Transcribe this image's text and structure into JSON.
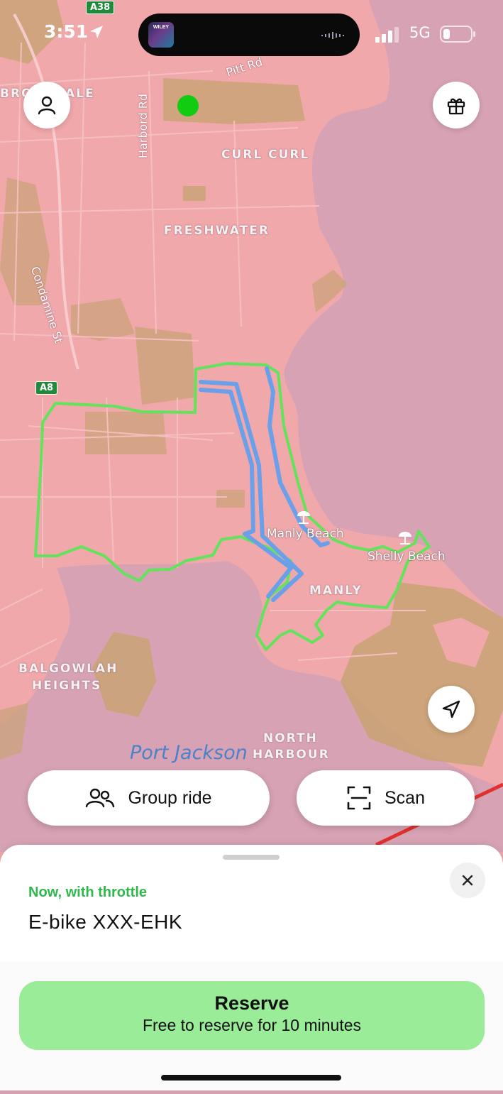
{
  "status_bar": {
    "time": "3:51",
    "network": "5G",
    "now_playing_art": "WILEY"
  },
  "map": {
    "place_labels": [
      "CURL CURL",
      "FRESHWATER",
      "MANLY",
      "BALGOWLAH",
      "HEIGHTS",
      "NORTH",
      "HARBOUR",
      "BROOKVALE"
    ],
    "road_labels": [
      "Pitt Rd",
      "Harbord Rd",
      "Condamine St"
    ],
    "shields": [
      "A38",
      "A8"
    ],
    "pois": [
      "Manly Beach",
      "Shelly Beach"
    ],
    "water_label": "Port Jackson",
    "colors": {
      "land": "#f0a8ab",
      "water": "#d7a3b4",
      "park": "#c9a376",
      "zone_outline": "#63e35c",
      "route": "#6a9fe9",
      "vehicle_marker": "#11cc11"
    }
  },
  "buttons": {
    "profile": "profile-icon",
    "gift": "gift-icon",
    "locate": "navigation-arrow-icon",
    "group_ride": "Group ride",
    "scan": "Scan"
  },
  "sheet": {
    "kicker": "Now, with throttle",
    "vehicle_name": "E-bike XXX-EHK",
    "reserve_title": "Reserve",
    "reserve_subtitle": "Free to reserve for 10 minutes"
  }
}
